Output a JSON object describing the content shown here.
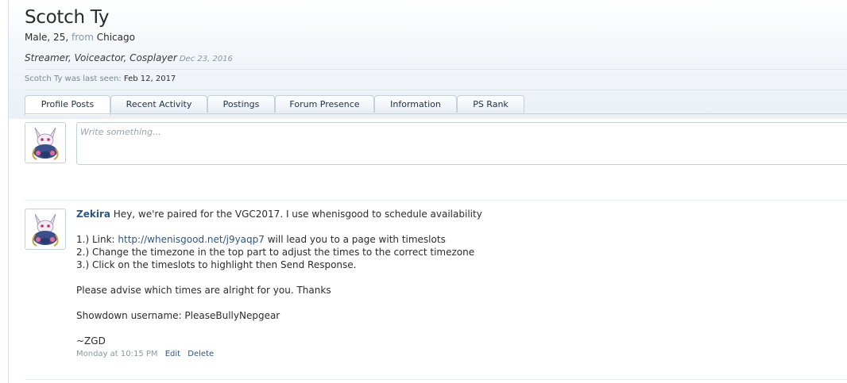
{
  "profile": {
    "name": "Scotch Ty",
    "gender_age": "Male, 25,",
    "from_word": "from",
    "location": "Chicago",
    "custom_title": "Streamer, Voiceactor, Cosplayer",
    "joined": "Dec 23, 2016",
    "last_seen_label": "Scotch Ty was last seen:",
    "last_seen_date": "Feb 12, 2017"
  },
  "tabs": [
    {
      "label": "Profile Posts"
    },
    {
      "label": "Recent Activity"
    },
    {
      "label": "Postings"
    },
    {
      "label": "Forum Presence"
    },
    {
      "label": "Information"
    },
    {
      "label": "PS Rank"
    }
  ],
  "status_input": {
    "placeholder": "Write something..."
  },
  "post": {
    "author": "Zekira",
    "line1": "Hey, we're paired for the VGC2017. I use whenisgood to schedule availability",
    "line2_pre": "1.) Link: ",
    "line2_link": "http://whenisgood.net/j9yaqp7",
    "line2_post": " will lead you to a page with timeslots",
    "line3": "2.) Change the timezone in the top part to adjust the times to the correct timezone",
    "line4": "3.) Click on the timeslots to highlight then Send Response.",
    "line5": "Please advise which times are alright for you. Thanks",
    "line6": "Showdown username: PleaseBullyNepgear",
    "line7": "~ZGD",
    "timestamp": "Monday at 10:15 PM",
    "edit_label": "Edit",
    "delete_label": "Delete"
  },
  "icons": {
    "avatar": "pokemon-avatar-icon"
  }
}
